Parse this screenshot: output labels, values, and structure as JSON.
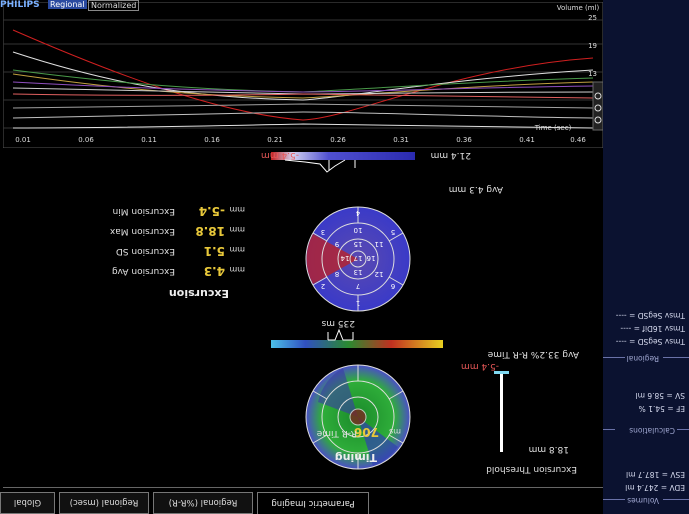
{
  "brand": {
    "name": "PHILIPS"
  },
  "graph_tabs": [
    "Regional",
    "Normalized"
  ],
  "time_axis": {
    "label": "Time (sec)",
    "ticks": [
      "0.01",
      "0.06",
      "0.11",
      "0.16",
      "0.21",
      "0.26",
      "0.31",
      "0.36",
      "0.41",
      "0.46"
    ]
  },
  "volume_axis": {
    "label": "Volume (ml)",
    "ticks": [
      "-3",
      "1",
      "7",
      "13",
      "19",
      "25"
    ]
  },
  "excursion": {
    "title": "Excursion",
    "scale_min": "-5.4 mm",
    "scale_max": "21.4 mm",
    "avg_label": "Avg 4.3 mm",
    "stats": [
      {
        "label": "Excursion Min",
        "value": "-5.4",
        "unit": "mm"
      },
      {
        "label": "Excursion Max",
        "value": "18.8",
        "unit": "mm"
      },
      {
        "label": "Excursion SD",
        "value": "5.1",
        "unit": "mm"
      },
      {
        "label": "Excursion Avg",
        "value": "4.3",
        "unit": "mm"
      }
    ],
    "segments": [
      "1",
      "2",
      "3",
      "4",
      "5",
      "6",
      "7",
      "8",
      "9",
      "10",
      "11",
      "12",
      "13",
      "14",
      "15",
      "16",
      "17"
    ]
  },
  "timing": {
    "title": "Timing",
    "scale_label": "235 ms",
    "avg_label": "Avg 33.2% R-R Time",
    "rr_label": "R-R Time",
    "rr_value": "706",
    "rr_unit": "ms",
    "segments": [
      "1",
      "2",
      "3",
      "4",
      "5",
      "6",
      "7",
      "8",
      "9",
      "10",
      "11",
      "12",
      "13",
      "14",
      "15",
      "16",
      "17"
    ]
  },
  "threshold": {
    "label": "Excursion Threshold",
    "top_value": "-5.4 mm",
    "bottom_value": "18.8 mm"
  },
  "tabs": [
    "Global",
    "Regional (msec)",
    "Regional (%R-R)",
    "Parametric Imaging"
  ],
  "side_panel": {
    "regional_items": [
      "Tmsv SegSD = ----",
      "Tmsv 16Dif = ----",
      "Tmsv SegSD = ----"
    ],
    "regional_header": "Regional",
    "calc_items": [
      "SV = 58.6 ml",
      "EF = 54.1 %"
    ],
    "calc_header": "Calculations",
    "vol_items": [
      "ESV = 187.7 ml",
      "EDV = 247.4 ml"
    ],
    "vol_header": "Volumes"
  },
  "colors": {
    "accent": "#e8c83a",
    "panel": "#0b1230",
    "threshold": "#7fd8f0"
  }
}
